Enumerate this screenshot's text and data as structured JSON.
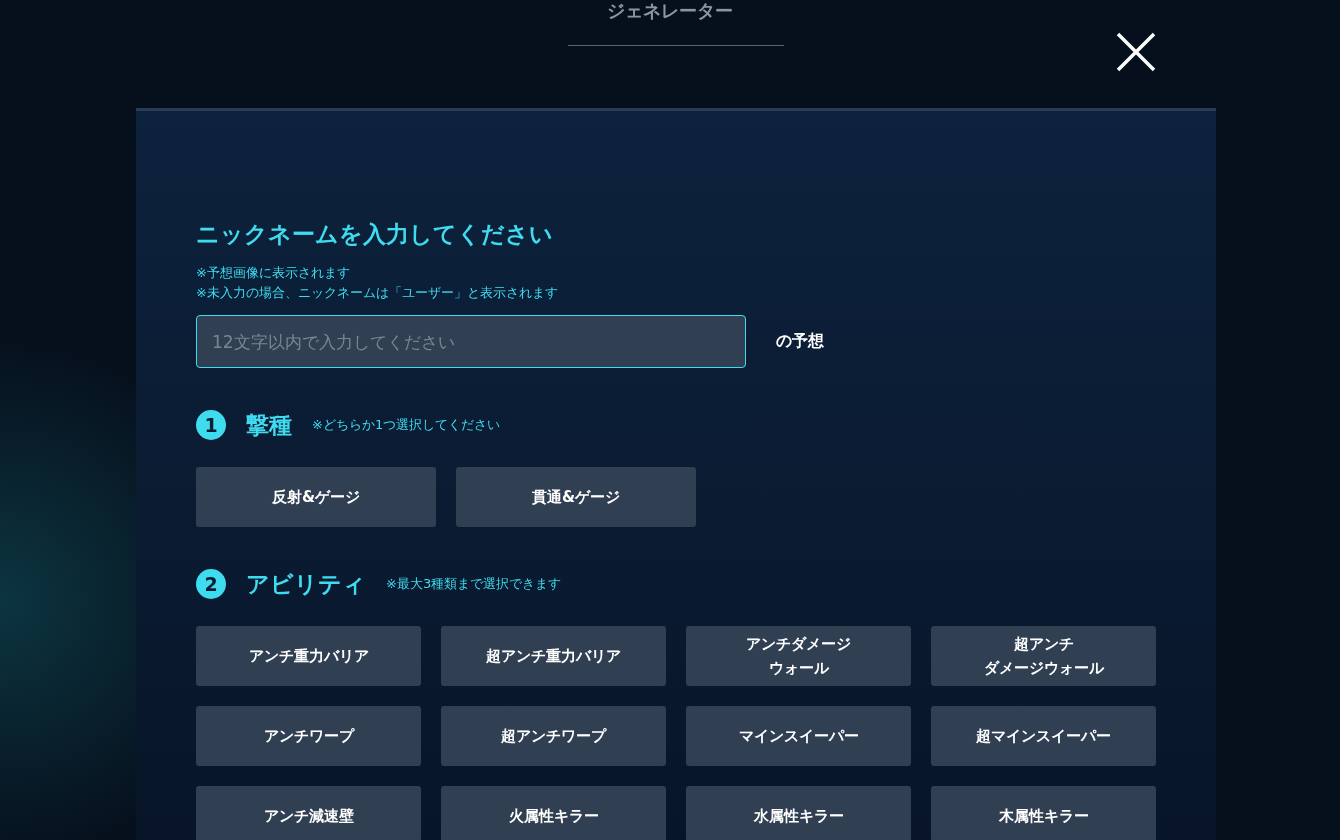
{
  "header": {
    "title": "ジェネレーター"
  },
  "nickname": {
    "heading": "ニックネームを入力してください",
    "notes": [
      "※予想画像に表示されます",
      "※未入力の場合、ニックネームは「ユーザー」と表示されます"
    ],
    "placeholder": "12文字以内で入力してください",
    "suffix": "の予想"
  },
  "sections": [
    {
      "number": "1",
      "title": "撃種",
      "note": "※どちらか1つ選択してください",
      "kind": "wide",
      "options": [
        {
          "label": "反射&ゲージ",
          "selected": false
        },
        {
          "label": "貫通&ゲージ",
          "selected": false
        }
      ]
    },
    {
      "number": "2",
      "title": "アビリティ",
      "note": "※最大3種類まで選択できます",
      "kind": "grid",
      "options": [
        {
          "label": "アンチ重力バリア",
          "selected": false
        },
        {
          "label": "超アンチ重力バリア",
          "selected": false
        },
        {
          "lines": [
            "アンチダメージ",
            "ウォール"
          ],
          "selected": false
        },
        {
          "lines": [
            "超アンチ",
            "ダメージウォール"
          ],
          "selected": false
        },
        {
          "label": "アンチワープ",
          "selected": false
        },
        {
          "label": "超アンチワープ",
          "selected": false
        },
        {
          "label": "マインスイーパー",
          "selected": false
        },
        {
          "label": "超マインスイーパー",
          "selected": false
        },
        {
          "label": "アンチ減速壁",
          "selected": false
        },
        {
          "label": "火属性キラー",
          "selected": false
        },
        {
          "label": "水属性キラー",
          "selected": false
        },
        {
          "label": "木属性キラー",
          "selected": false
        }
      ]
    }
  ]
}
